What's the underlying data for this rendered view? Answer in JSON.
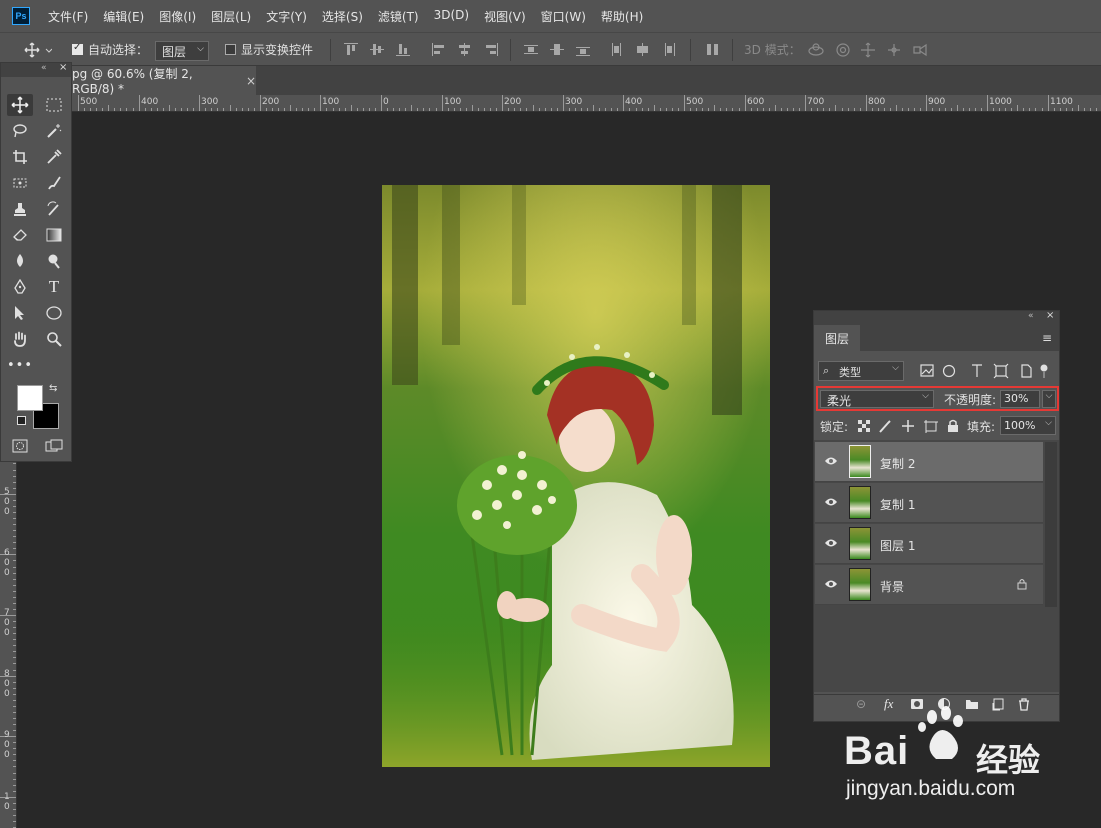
{
  "app": {
    "logo": "Ps"
  },
  "menu": [
    "文件(F)",
    "编辑(E)",
    "图像(I)",
    "图层(L)",
    "文字(Y)",
    "选择(S)",
    "滤镜(T)",
    "3D(D)",
    "视图(V)",
    "窗口(W)",
    "帮助(H)"
  ],
  "options": {
    "auto_select_label": "自动选择：",
    "auto_select_value": "图层",
    "show_transform_label": "显示变换控件",
    "mode_3d_label": "3D 模式："
  },
  "document": {
    "tab_title": "pg @ 60.6% (复制 2, RGB/8) *",
    "close": "×"
  },
  "ruler": {
    "h_labels": [
      "500",
      "400",
      "300",
      "200",
      "100",
      "0",
      "100",
      "200",
      "300",
      "400",
      "500",
      "600",
      "700",
      "800",
      "900",
      "1000",
      "1100"
    ],
    "v_labels": [
      "5\n0\n0",
      "6\n0\n0",
      "7\n0\n0",
      "8\n0\n0",
      "9\n0\n0",
      "1\n0"
    ]
  },
  "layers_panel": {
    "tab": "图层",
    "filter_kind": "类型",
    "blend_mode": "柔光",
    "opacity_label": "不透明度:",
    "opacity_value": "30%",
    "lock_label": "锁定:",
    "fill_label": "填充:",
    "fill_value": "100%",
    "layers": [
      {
        "name": "复制 2",
        "selected": true
      },
      {
        "name": "复制 1",
        "selected": false
      },
      {
        "name": "图层 1",
        "selected": false
      },
      {
        "name": "背景",
        "selected": false,
        "locked": true
      }
    ],
    "footer_fx": "fx"
  },
  "watermark": {
    "brand": "Bai",
    "brand_tail": "经验",
    "url": "jingyan.baidu.com"
  },
  "colors": {
    "accent_red": "#e53935",
    "ps_blue": "#31a8ff"
  }
}
